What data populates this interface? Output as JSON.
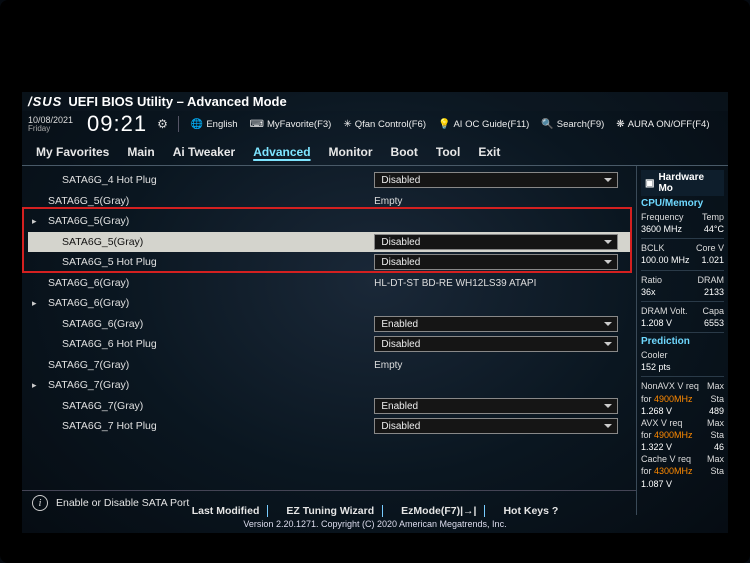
{
  "header": {
    "logo": "/SUS",
    "title": "UEFI BIOS Utility – Advanced Mode",
    "date": "10/08/2021",
    "weekday": "Friday",
    "time": "09:21",
    "toolbar": {
      "language": "English",
      "myfav": "MyFavorite(F3)",
      "qfan": "Qfan Control(F6)",
      "aioc": "AI OC Guide(F11)",
      "search": "Search(F9)",
      "aura": "AURA ON/OFF(F4)"
    }
  },
  "tabs": {
    "items": [
      "My Favorites",
      "Main",
      "Ai Tweaker",
      "Advanced",
      "Monitor",
      "Boot",
      "Tool",
      "Exit"
    ],
    "active": 3
  },
  "rows": [
    {
      "label": "SATA6G_4 Hot Plug",
      "type": "dd",
      "value": "Disabled",
      "indent": true
    },
    {
      "label": "SATA6G_5(Gray)",
      "type": "static",
      "value": "Empty"
    },
    {
      "label": "SATA6G_5(Gray)",
      "type": "none",
      "parent": true
    },
    {
      "label": "SATA6G_5(Gray)",
      "type": "dd",
      "value": "Disabled",
      "indent": true,
      "selected": true
    },
    {
      "label": "SATA6G_5 Hot Plug",
      "type": "dd",
      "value": "Disabled",
      "indent": true
    },
    {
      "label": "SATA6G_6(Gray)",
      "type": "static",
      "value": "HL-DT-ST BD-RE  WH12LS39 ATAPI"
    },
    {
      "label": "SATA6G_6(Gray)",
      "type": "none",
      "parent": true
    },
    {
      "label": "SATA6G_6(Gray)",
      "type": "dd",
      "value": "Enabled",
      "indent": true
    },
    {
      "label": "SATA6G_6 Hot Plug",
      "type": "dd",
      "value": "Disabled",
      "indent": true
    },
    {
      "label": "SATA6G_7(Gray)",
      "type": "static",
      "value": "Empty"
    },
    {
      "label": "SATA6G_7(Gray)",
      "type": "none",
      "parent": true
    },
    {
      "label": "SATA6G_7(Gray)",
      "type": "dd",
      "value": "Enabled",
      "indent": true
    },
    {
      "label": "SATA6G_7 Hot Plug",
      "type": "dd",
      "value": "Disabled",
      "indent": true
    }
  ],
  "help_text": "Enable or Disable SATA Port",
  "right": {
    "header": "Hardware Mo",
    "cpu_header": "CPU/Memory",
    "freq_l": "Frequency",
    "freq_v": "3600 MHz",
    "temp_l": "Temp",
    "temp_v": "44°C",
    "bclk_l": "BCLK",
    "bclk_v": "100.00 MHz",
    "core_l": "Core V",
    "core_v": "1.021",
    "ratio_l": "Ratio",
    "ratio_v": "36x",
    "dram_l": "DRAM",
    "dram_v": "2133",
    "dvolt_l": "DRAM Volt.",
    "dvolt_v": "1.208 V",
    "cap_l": "Capa",
    "cap_v": "6553",
    "pred_header": "Prediction",
    "cooler_l": "Cooler",
    "cooler_v": "152 pts",
    "nonavx_l": "NonAVX V req",
    "nonavx_f": "for 4900MHz",
    "nonavx_v": "1.268 V",
    "nonavx_s": "489",
    "avx_l": "AVX V req",
    "avx_f": "for 4900MHz",
    "avx_v": "1.322 V",
    "avx_s": "46",
    "cache_l": "Cache V req",
    "cache_f": "for 4300MHz",
    "cache_v": "1.087 V",
    "max_l": "Max",
    "sta_l": "Sta"
  },
  "footer": {
    "links": [
      "Last Modified",
      "EZ Tuning Wizard",
      "EzMode(F7)|→|",
      "Hot Keys ?"
    ],
    "version": "Version 2.20.1271. Copyright (C) 2020 American Megatrends, Inc."
  }
}
